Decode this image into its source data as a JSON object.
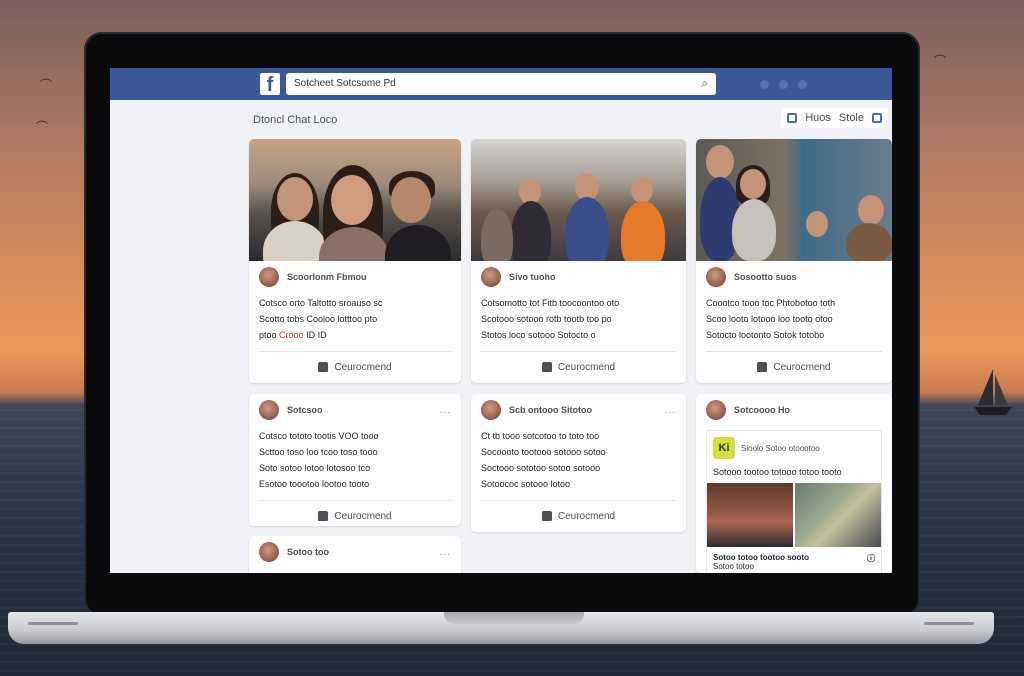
{
  "header": {
    "logo": "f",
    "search_value": "Sotcheet Sotcsome Pd"
  },
  "feed": {
    "title": "Dtoncl Chat Loco",
    "actions": [
      {
        "label": "Huos"
      },
      {
        "label": "Stole"
      }
    ]
  },
  "cards": [
    {
      "name": "Scoorlonm Fbmou",
      "lines": [
        "Cotsco orto Taltotto sroauso sc",
        "Scotto tobs Cooloo lotttoo pto",
        "ptoo"
      ],
      "highlight": "Crooo",
      "highlight_tail": "ID ID",
      "action": "Ceurocmend"
    },
    {
      "name": "Sivo tuoho",
      "lines": [
        "Cotsomotto tot Fitb toocoontoo oto",
        "Scotooo sotooo rotb tootb too po",
        "Stotos loco sotooo Sotocto o"
      ],
      "action": "Ceurocmend"
    },
    {
      "name": "Sosootto suos",
      "lines": [
        "Coootco tooo toc Phtobotoo toth",
        "Scoo looto lotooo loo tooto otoo",
        "Sotocto lootonto Sotok totobo"
      ],
      "action": "Ceurocmend"
    },
    {
      "name": "Sotcsoo",
      "lines": [
        "Cotsco tototo tootis VOO tooo",
        "Scttoo toso loo tcoo toso tooo",
        "Soto sotoo lotoo lotosoo tco",
        "Esotoo toootoo lootoo tooto"
      ],
      "action": "Ceurocmend",
      "more": "..."
    },
    {
      "name": "Scb ontooo Sitotoo",
      "lines": [
        "Ct tb tooo sotcotoo to toto too",
        "Socoooto tootooo sotooo sotoo",
        "Soctooo sototoo sotoo sotooo",
        "Sotoococ sotooo lotoo"
      ],
      "action": "Ceurocmend",
      "more": "..."
    },
    {
      "name": "Sotcoooo Ho",
      "share_badge": "Ki",
      "share_title": "Sioolo Sotoo otoootoo",
      "share_text": "Sotooo tootoo totooo totoo tooto",
      "share_foot_left": "Sotoo totoo tootoo sooto",
      "share_foot_sub": "Sotoo totoo"
    },
    {
      "name": "Sotoo too",
      "more": "..."
    }
  ]
}
